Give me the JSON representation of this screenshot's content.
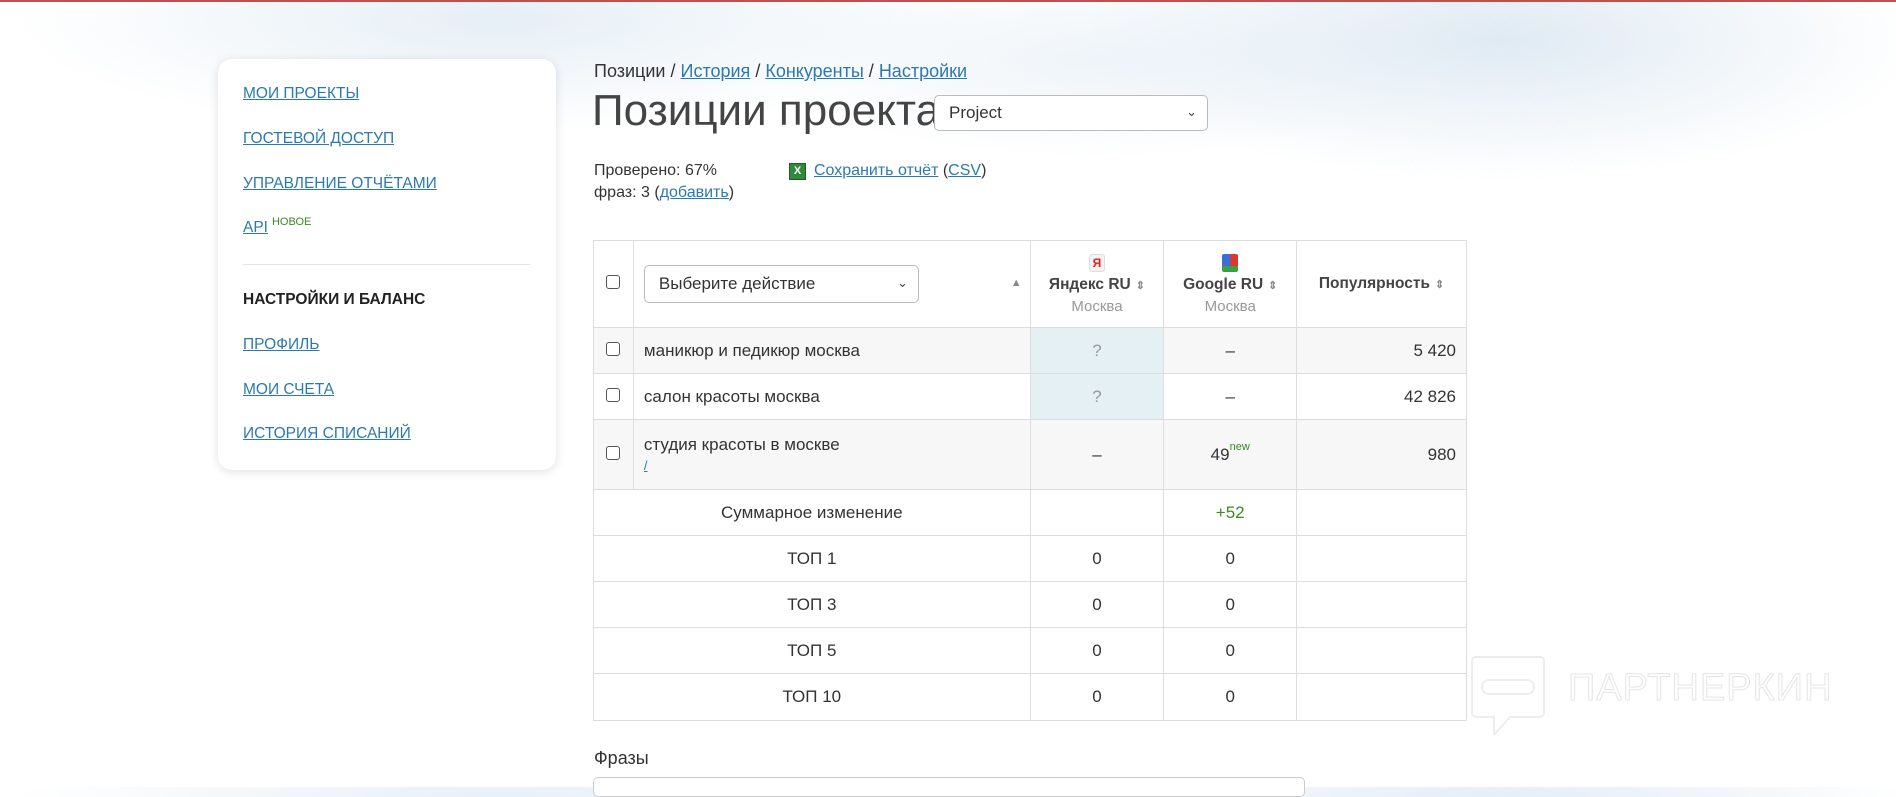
{
  "sidebar": {
    "items": [
      {
        "label": "Мои проекты"
      },
      {
        "label": "Гостевой доступ"
      },
      {
        "label": "Управление отчётами"
      },
      {
        "label": "API",
        "badge": "НОВОЕ"
      }
    ],
    "section_title": "НАСТРОЙКИ И БАЛАНС",
    "section_items": [
      {
        "label": "Профиль"
      },
      {
        "label": "Мои счета"
      },
      {
        "label": "История списаний"
      }
    ]
  },
  "breadcrumb": {
    "current": "Позиции",
    "sep": " / ",
    "links": [
      "История",
      "Конкуренты",
      "Настройки"
    ]
  },
  "header": {
    "title": "Позиции проекта:",
    "project_select": "Project"
  },
  "stats": {
    "checked": "Проверено: 67%",
    "phrases_prefix": "фраз: 3 (",
    "add_link": "добавить",
    "phrases_suffix": ")"
  },
  "report": {
    "save_link": "Сохранить отчёт",
    "csv_link": "CSV",
    "open": " (",
    "close": ")",
    "icon": "excel-icon"
  },
  "table": {
    "action_select": "Выберите действие",
    "columns": [
      {
        "label": "Яндекс RU",
        "region": "Москва",
        "icon": "yandex-icon"
      },
      {
        "label": "Google RU",
        "region": "Москва",
        "icon": "google-icon"
      },
      {
        "label": "Популярность"
      }
    ],
    "rows": [
      {
        "phrase": "маникюр и педикюр москва",
        "yandex": "?",
        "google": "–",
        "popularity": "5 420"
      },
      {
        "phrase": "салон красоты москва",
        "yandex": "?",
        "google": "–",
        "popularity": "42 826"
      },
      {
        "phrase": "студия красоты в москве",
        "url": "/",
        "yandex": "–",
        "google": "49",
        "google_badge": "new",
        "popularity": "980"
      }
    ],
    "summary": [
      {
        "label": "Суммарное изменение",
        "yandex": "",
        "google": "+52"
      },
      {
        "label": "ТОП 1",
        "yandex": "0",
        "google": "0"
      },
      {
        "label": "ТОП 3",
        "yandex": "0",
        "google": "0"
      },
      {
        "label": "ТОП 5",
        "yandex": "0",
        "google": "0"
      },
      {
        "label": "ТОП 10",
        "yandex": "0",
        "google": "0"
      }
    ]
  },
  "phrases_label": "Фразы",
  "watermark": "ПАРТНЕРКИН"
}
